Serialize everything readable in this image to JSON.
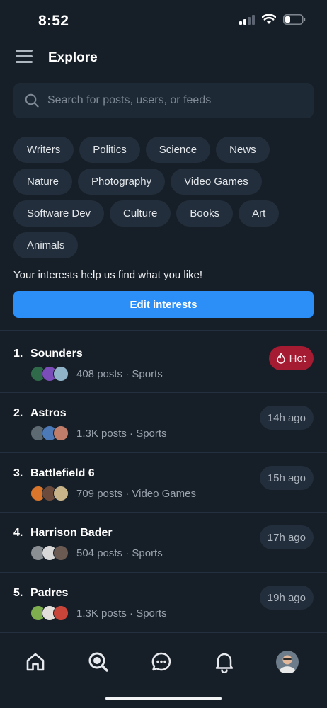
{
  "status_bar": {
    "time": "8:52"
  },
  "header": {
    "title": "Explore"
  },
  "search": {
    "placeholder": "Search for posts, users, or feeds"
  },
  "interests": {
    "chips": [
      "Writers",
      "Politics",
      "Science",
      "News",
      "Nature",
      "Photography",
      "Video Games",
      "Software Dev",
      "Culture",
      "Books",
      "Art",
      "Animals"
    ],
    "note": "Your interests help us find what you like!",
    "edit_label": "Edit interests"
  },
  "trending": [
    {
      "rank": "1.",
      "name": "Sounders",
      "meta": "408 posts · Sports",
      "badge": "Hot",
      "badge_type": "hot",
      "avatar_colors": [
        "#2f6b4a",
        "#7a4db8",
        "#8fb3c9"
      ]
    },
    {
      "rank": "2.",
      "name": "Astros",
      "meta": "1.3K posts · Sports",
      "badge": "14h ago",
      "badge_type": "time",
      "avatar_colors": [
        "#5d6a72",
        "#4c79b8",
        "#c07d6a"
      ]
    },
    {
      "rank": "3.",
      "name": "Battlefield 6",
      "meta": "709 posts · Video Games",
      "badge": "15h ago",
      "badge_type": "time",
      "avatar_colors": [
        "#d9762b",
        "#6d4b3c",
        "#c9b48a"
      ]
    },
    {
      "rank": "4.",
      "name": "Harrison Bader",
      "meta": "504 posts · Sports",
      "badge": "17h ago",
      "badge_type": "time",
      "avatar_colors": [
        "#8a8f94",
        "#d8d8d8",
        "#6a5a52"
      ]
    },
    {
      "rank": "5.",
      "name": "Padres",
      "meta": "1.3K posts · Sports",
      "badge": "19h ago",
      "badge_type": "time",
      "avatar_colors": [
        "#7fae4f",
        "#e3e0dc",
        "#c9453a"
      ]
    }
  ],
  "colors": {
    "accent": "#2b8ff7",
    "hot": "#a51b32",
    "background": "#161e27"
  },
  "bottom_nav": [
    "home-icon",
    "search-icon",
    "chat-icon",
    "bell-icon",
    "profile-avatar"
  ]
}
